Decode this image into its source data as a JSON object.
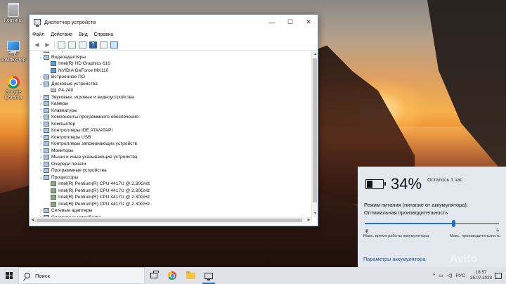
{
  "desktop": {
    "icons": [
      {
        "label": "Корзина"
      },
      {
        "label": "Этот компьютер"
      },
      {
        "label": "Google Chrome"
      }
    ]
  },
  "window": {
    "title": "Диспетчер устройств",
    "menu": [
      "Файл",
      "Действие",
      "Вид",
      "Справка"
    ],
    "tree": [
      {
        "label": "Батареи",
        "level": 0,
        "expander": "›"
      },
      {
        "label": "Видеоадаптеры",
        "level": 0,
        "expander": "⌄"
      },
      {
        "label": "Intel(R) HD Graphics 610",
        "level": 1,
        "expander": ""
      },
      {
        "label": "NVIDIA GeForce MX110",
        "level": 1,
        "expander": ""
      },
      {
        "label": "Встроенное ПО",
        "level": 0,
        "expander": "›"
      },
      {
        "label": "Дисковые устройства",
        "level": 0,
        "expander": "⌄"
      },
      {
        "label": "P4-240",
        "level": 1,
        "expander": ""
      },
      {
        "label": "Звуковые, игровые и видеоустройства",
        "level": 0,
        "expander": "›"
      },
      {
        "label": "Камеры",
        "level": 0,
        "expander": "›"
      },
      {
        "label": "Клавиатуры",
        "level": 0,
        "expander": "›"
      },
      {
        "label": "Компоненты программного обеспечения",
        "level": 0,
        "expander": "›"
      },
      {
        "label": "Компьютер",
        "level": 0,
        "expander": "›"
      },
      {
        "label": "Контроллеры IDE ATA/ATAPI",
        "level": 0,
        "expander": "›"
      },
      {
        "label": "Контроллеры USB",
        "level": 0,
        "expander": "›"
      },
      {
        "label": "Контроллеры запоминающих устройств",
        "level": 0,
        "expander": "›"
      },
      {
        "label": "Мониторы",
        "level": 0,
        "expander": "›"
      },
      {
        "label": "Мыши и иные указывающие устройства",
        "level": 0,
        "expander": "›"
      },
      {
        "label": "Очереди печати",
        "level": 0,
        "expander": "›"
      },
      {
        "label": "Программные устройства",
        "level": 0,
        "expander": "›"
      },
      {
        "label": "Процессоры",
        "level": 0,
        "expander": "⌄"
      },
      {
        "label": "Intel(R) Pentium(R) CPU 4417U @ 2.30GHz",
        "level": 1,
        "expander": ""
      },
      {
        "label": "Intel(R) Pentium(R) CPU 4417U @ 2.30GHz",
        "level": 1,
        "expander": ""
      },
      {
        "label": "Intel(R) Pentium(R) CPU 4417U @ 2.30GHz",
        "level": 1,
        "expander": ""
      },
      {
        "label": "Intel(R) Pentium(R) CPU 4417U @ 2.30GHz",
        "level": 1,
        "expander": ""
      },
      {
        "label": "Сетевые адаптеры",
        "level": 0,
        "expander": "›"
      },
      {
        "label": "Системные устройства",
        "level": 0,
        "expander": "›"
      }
    ]
  },
  "battery": {
    "percent": "34%",
    "level_fraction": 0.34,
    "remaining": "Осталось 1 час",
    "mode_label": "Режим питания (питание от аккумулятора):",
    "mode_value": "Оптимальная производительность",
    "slider_fraction": 0.66,
    "left_caption": "Макс. время работы аккумулятора",
    "right_caption": "Макс. производительность",
    "settings_link": "Параметры аккумулятора"
  },
  "taskbar": {
    "search_placeholder": "Поиск",
    "language": "РУС",
    "time": "18:57",
    "date": "25.07.2023"
  },
  "watermark": "Avito"
}
